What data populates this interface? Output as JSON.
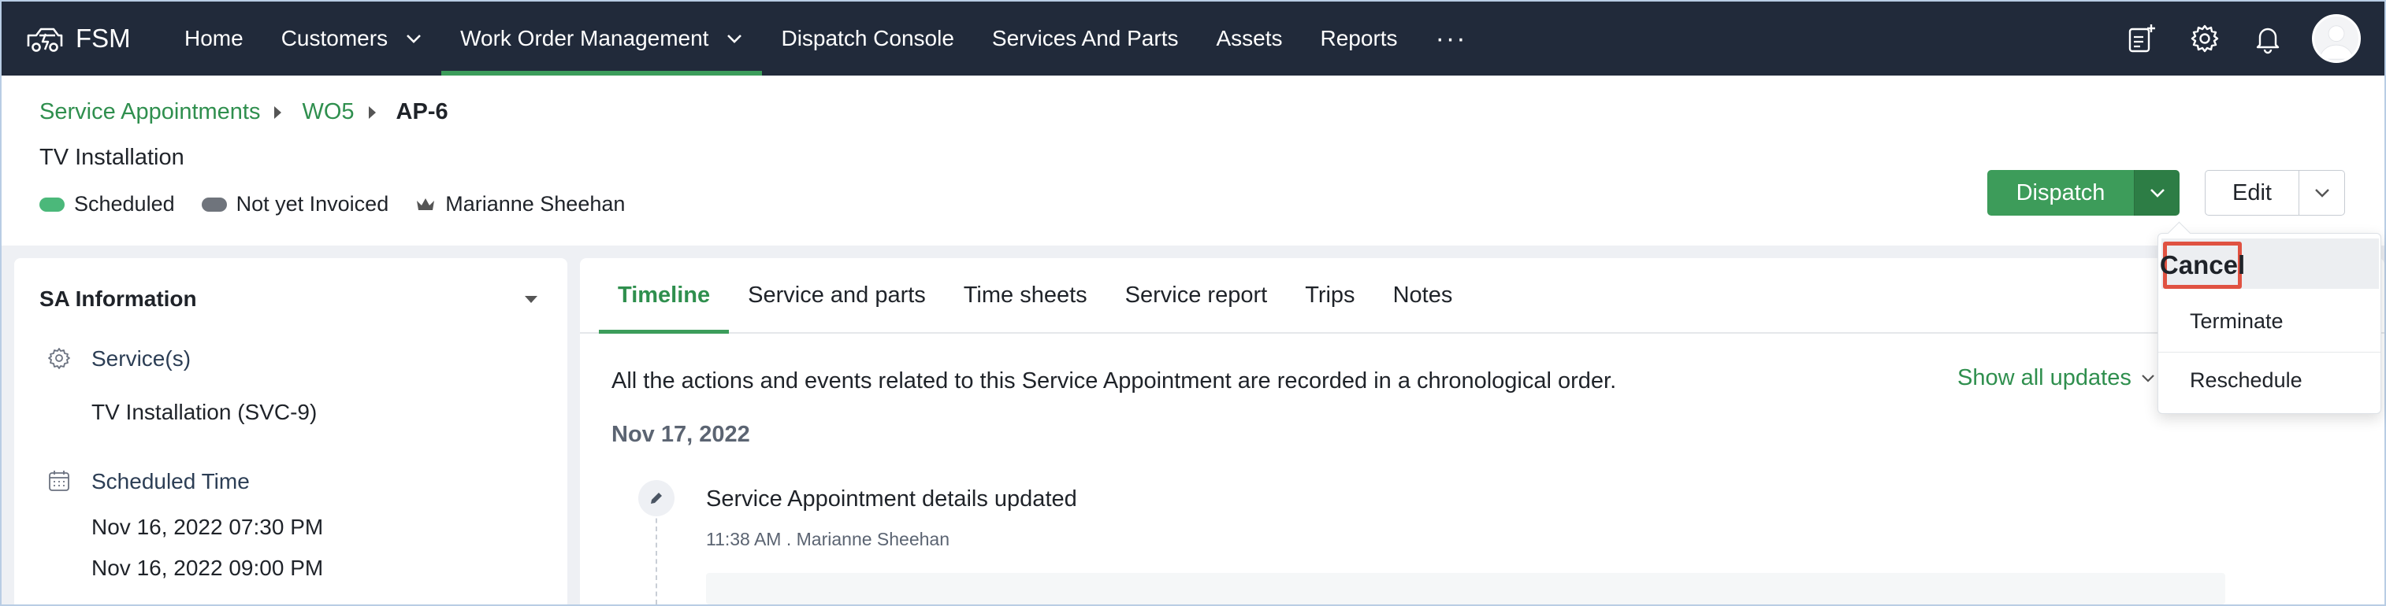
{
  "nav": {
    "brand": "FSM",
    "items": [
      {
        "label": "Home",
        "has_dropdown": false,
        "active": false
      },
      {
        "label": "Customers",
        "has_dropdown": true,
        "active": false
      },
      {
        "label": "Work Order Management",
        "has_dropdown": true,
        "active": true
      },
      {
        "label": "Dispatch Console",
        "has_dropdown": false,
        "active": false
      },
      {
        "label": "Services And Parts",
        "has_dropdown": false,
        "active": false
      },
      {
        "label": "Assets",
        "has_dropdown": false,
        "active": false
      },
      {
        "label": "Reports",
        "has_dropdown": false,
        "active": false
      }
    ],
    "more": "···",
    "icons": [
      "new-note-icon",
      "gear-icon",
      "bell-icon",
      "avatar"
    ]
  },
  "header": {
    "breadcrumb": [
      "Service Appointments",
      "WO5",
      "AP-6"
    ],
    "title": "TV Installation",
    "tags": [
      {
        "label": "Scheduled",
        "color": "#4bb87a"
      },
      {
        "label": "Not yet Invoiced",
        "color": "#6f747c"
      },
      {
        "label": "Marianne Sheehan",
        "icon": "crown-icon"
      }
    ],
    "dispatch_label": "Dispatch",
    "edit_label": "Edit"
  },
  "sa_info": {
    "heading": "SA Information",
    "services_label": "Service(s)",
    "services_value": "TV Installation (SVC-9)",
    "scheduled_label": "Scheduled Time",
    "scheduled_start": "Nov 16, 2022 07:30 PM",
    "scheduled_end": "Nov 16, 2022 09:00 PM"
  },
  "tabs": [
    {
      "label": "Timeline",
      "active": true
    },
    {
      "label": "Service and parts",
      "active": false
    },
    {
      "label": "Time sheets",
      "active": false
    },
    {
      "label": "Service report",
      "active": false
    },
    {
      "label": "Trips",
      "active": false
    },
    {
      "label": "Notes",
      "active": false
    }
  ],
  "timeline": {
    "description": "All the actions and events related to this Service Appointment are recorded in a chronological order.",
    "show_all": "Show all updates",
    "date": "Nov 17, 2022",
    "event_title": "Service Appointment details updated",
    "event_meta": "11:38 AM . Marianne Sheehan"
  },
  "dropdown": {
    "items": [
      "Cancel",
      "Terminate",
      "Reschedule"
    ],
    "highlight_color": "#e05242"
  },
  "colors": {
    "nav_bg": "#212a3a",
    "accent_green": "#3d9c5a",
    "link_green": "#2f8f4e"
  }
}
